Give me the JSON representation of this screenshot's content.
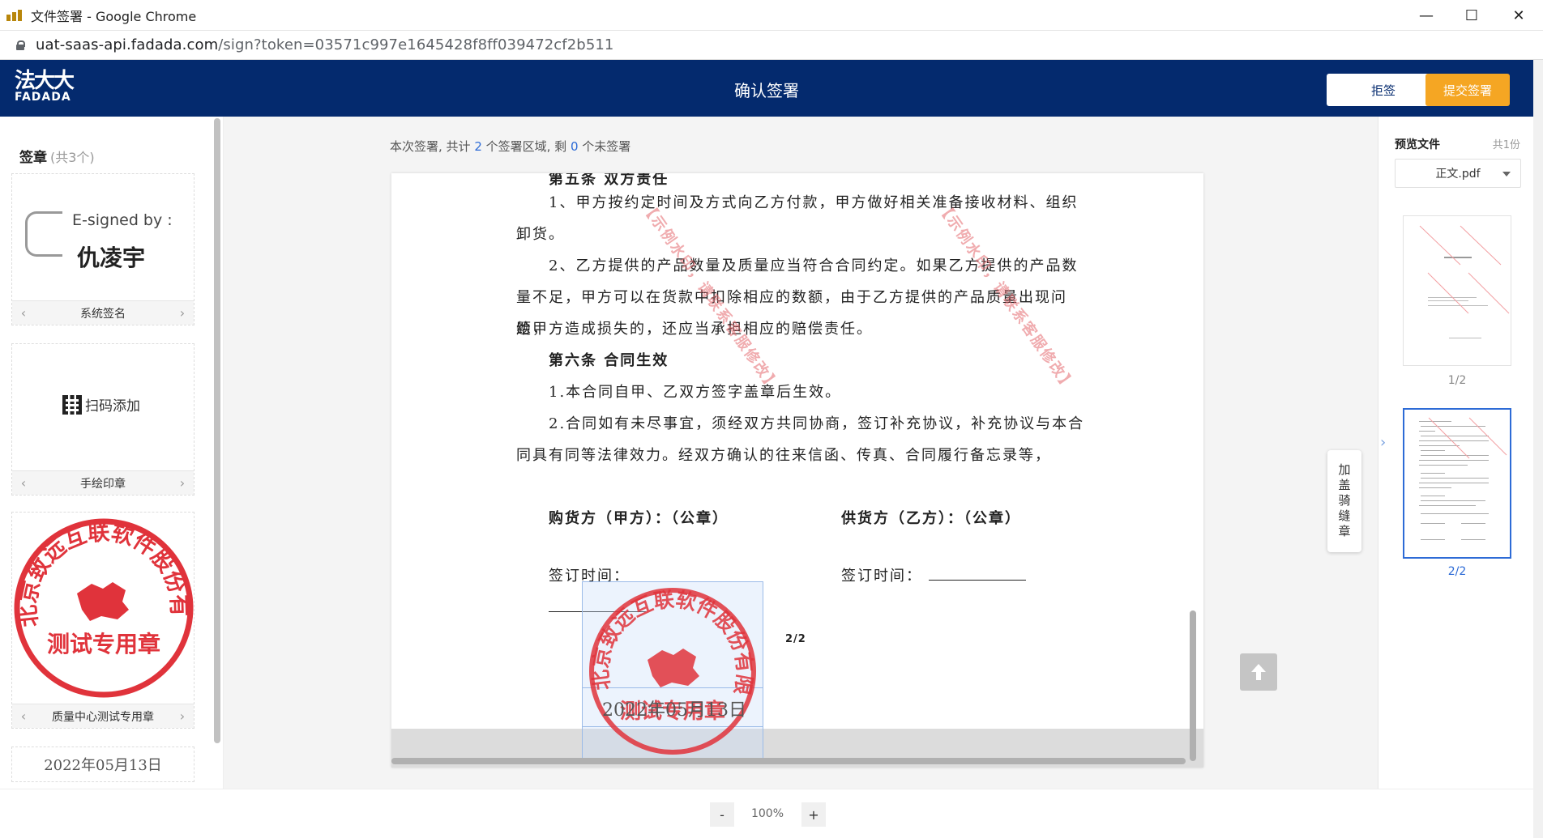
{
  "browser": {
    "window_title": "文件签署 - Google Chrome",
    "url_host": "uat-saas-api.fadada.com",
    "url_path": "/sign?token=03571c997e1645428f8ff039472cf2b511"
  },
  "header": {
    "logo_cn": "法大大",
    "logo_en": "FADADA",
    "title": "确认签署",
    "reject_label": "拒签",
    "submit_label": "提交签署"
  },
  "left_panel": {
    "title": "签章",
    "count": "(共3个)",
    "cards": [
      {
        "esign_by": "E-signed by :",
        "esign_name": "仇凌宇",
        "label": "系统签名"
      },
      {
        "add_label": "扫码添加",
        "label": "手绘印章"
      },
      {
        "seal_text": "北京致远互联软件股份有限公司质量中心",
        "seal_sub": "测试专用章",
        "label": "质量中心测试专用章"
      }
    ],
    "date_card": "2022年05月13日"
  },
  "main": {
    "info_prefix": "本次签署, 共计 ",
    "info_total": "2",
    "info_mid": " 个签署区域, 剩 ",
    "info_remaining": "0",
    "info_suffix": " 个未签署",
    "doc": {
      "line_heading5": "第五条   双方责任",
      "p1a": "1、甲方按约定时间及方式向乙方付款，甲方做好相关准备接收材料、组织",
      "p1b": "卸货。",
      "p2a": "2、乙方提供的产品数量及质量应当符合合同约定。如果乙方提供的产品数",
      "p2b": "量不足，甲方可以在货款中扣除相应的数额，由于乙方提供的产品质量出现问题，",
      "p2c": "给甲方造成损失的，还应当承担相应的赔偿责任。",
      "heading6": "第六条  合同生效",
      "p3": "1.本合同自甲、乙双方签字盖章后生效。",
      "p4a": "2.合同如有未尽事宜，须经双方共同协商，签订补充协议，补充协议与本合",
      "p4b": "同具有同等法律效力。经双方确认的往来信函、传真、合同履行备忘录等，",
      "buyer": "购货方（甲方）：（公章）",
      "seller": "供货方（乙方）：（公章）",
      "sign_time_buyer": "签订时间：",
      "sign_time_seller": "签订时间：",
      "watermark": "【示例水印，请联系客服修改】",
      "page_num": "2/2",
      "sig_date": "2022年05月13日"
    },
    "ride_seal": "加盖骑缝章"
  },
  "right_panel": {
    "title": "预览文件",
    "count": "共1份",
    "file": "正文.pdf",
    "pages": [
      "1/2",
      "2/2"
    ]
  },
  "bottom": {
    "zoom_out": "-",
    "zoom": "100%",
    "zoom_in": "+"
  },
  "colors": {
    "header_bg": "#042a6e",
    "submit_bg": "#f5a623",
    "seal_red": "#e0333b",
    "accent_blue": "#2d6bd6"
  }
}
